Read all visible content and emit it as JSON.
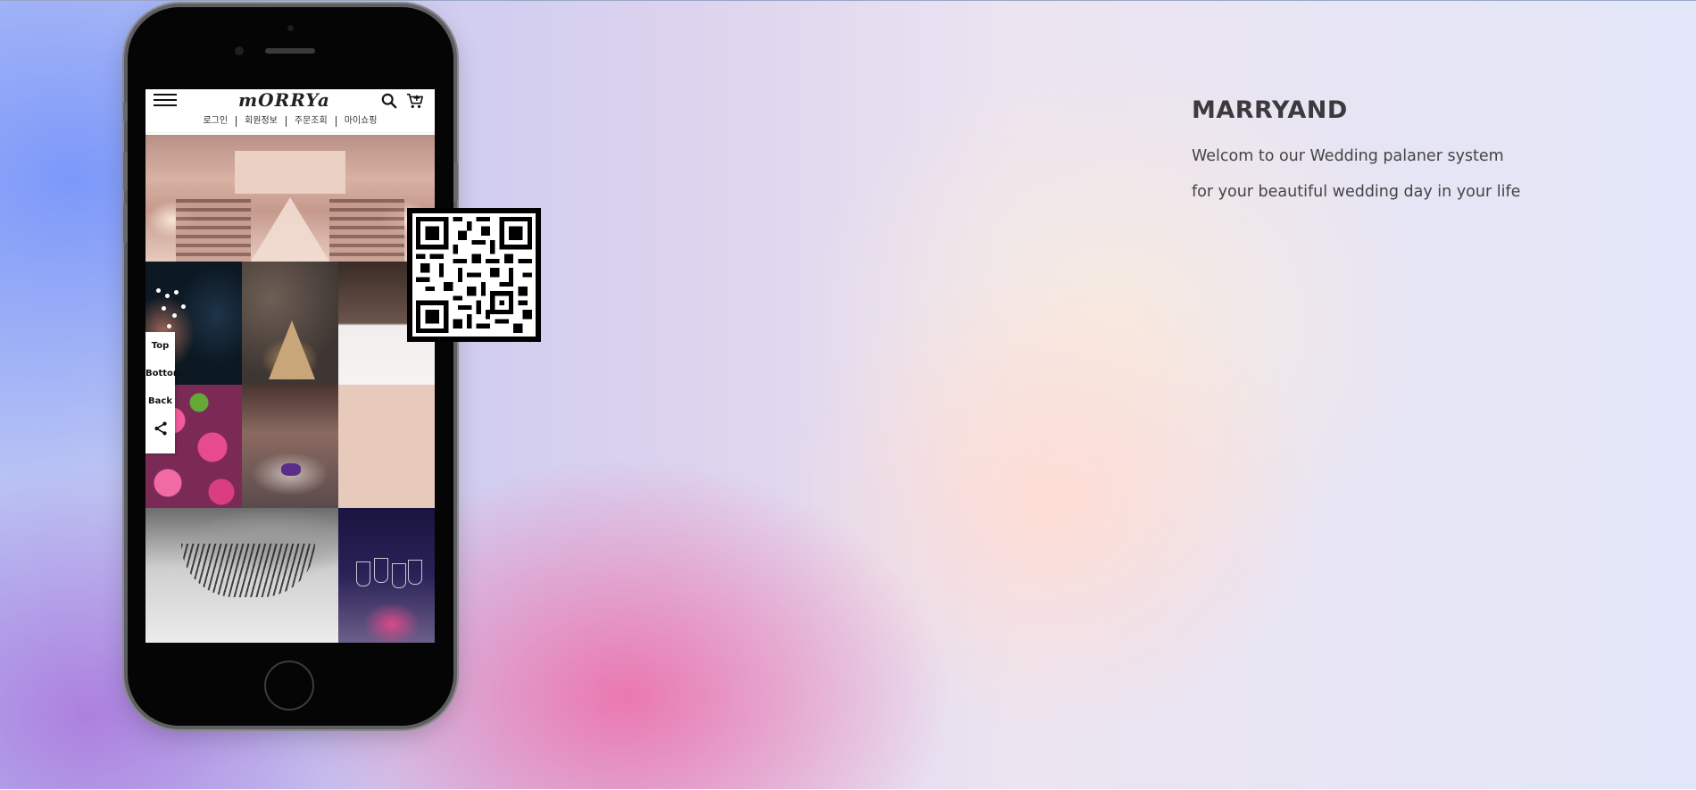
{
  "phone": {
    "header": {
      "logo_text": "mORRYa",
      "menu_icon": "hamburger-icon",
      "search_icon": "search-icon",
      "cart_icon": "cart-icon"
    },
    "subnav": [
      {
        "label": "로그인"
      },
      {
        "label": "회원정보"
      },
      {
        "label": "주문조회"
      },
      {
        "label": "마이쇼핑"
      }
    ],
    "gallery": [
      {
        "subject": "wedding-hall-photo"
      },
      {
        "subject": "jeweled-makeup-photo"
      },
      {
        "subject": "bride-gown-photo"
      },
      {
        "subject": "makeup-brush-photo"
      },
      {
        "subject": "pink-roses-photo"
      },
      {
        "subject": "table-setting-photo"
      },
      {
        "subject": "blush-color-tile"
      },
      {
        "subject": "eyelash-closeup-photo"
      },
      {
        "subject": "wine-glasses-photo"
      }
    ],
    "floating_menu": {
      "top": "Top",
      "bottom": "Bottom",
      "back": "Back",
      "share_icon": "share-icon"
    }
  },
  "qr_code": {
    "icon": "qr-code"
  },
  "intro": {
    "title": "MARRYAND",
    "line1": "Welcom to our Wedding palaner system",
    "line2": "for your beautiful wedding day in your life"
  },
  "colors": {
    "title": "#3b3b3d",
    "text": "#444444",
    "phone_body": "#050505",
    "blush_tile": "#e8cabd"
  }
}
